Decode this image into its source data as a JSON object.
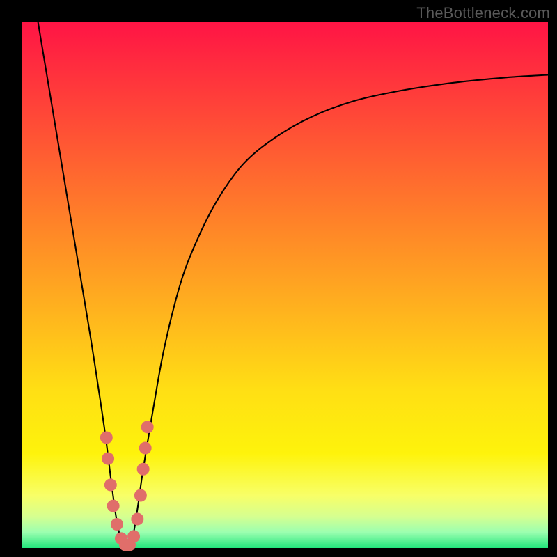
{
  "watermark": "TheBottleneck.com",
  "colors": {
    "curve": "#000000",
    "marker_fill": "#e06e6a",
    "marker_stroke": "#c75955"
  },
  "chart_data": {
    "type": "line",
    "title": "",
    "xlabel": "",
    "ylabel": "",
    "xlim": [
      0,
      100
    ],
    "ylim": [
      0,
      100
    ],
    "curve": {
      "x": [
        3,
        5,
        7,
        9,
        11,
        13,
        15,
        16,
        17,
        18,
        19,
        20,
        21,
        22,
        23,
        25,
        27,
        30,
        33,
        37,
        42,
        48,
        55,
        63,
        72,
        82,
        92,
        100
      ],
      "y": [
        100,
        88,
        76,
        64,
        52,
        40,
        27,
        20,
        12,
        5,
        1,
        0,
        2,
        8,
        15,
        27,
        38,
        50,
        58,
        66,
        73,
        78,
        82,
        85,
        87,
        88.5,
        89.5,
        90
      ]
    },
    "markers": [
      {
        "x": 16.0,
        "y": 21
      },
      {
        "x": 16.3,
        "y": 17
      },
      {
        "x": 16.8,
        "y": 12
      },
      {
        "x": 17.3,
        "y": 8
      },
      {
        "x": 18.0,
        "y": 4.5
      },
      {
        "x": 18.8,
        "y": 1.8
      },
      {
        "x": 19.6,
        "y": 0.6
      },
      {
        "x": 20.4,
        "y": 0.6
      },
      {
        "x": 21.2,
        "y": 2.2
      },
      {
        "x": 21.9,
        "y": 5.5
      },
      {
        "x": 22.5,
        "y": 10
      },
      {
        "x": 23.0,
        "y": 15
      },
      {
        "x": 23.4,
        "y": 19
      },
      {
        "x": 23.8,
        "y": 23
      }
    ]
  }
}
